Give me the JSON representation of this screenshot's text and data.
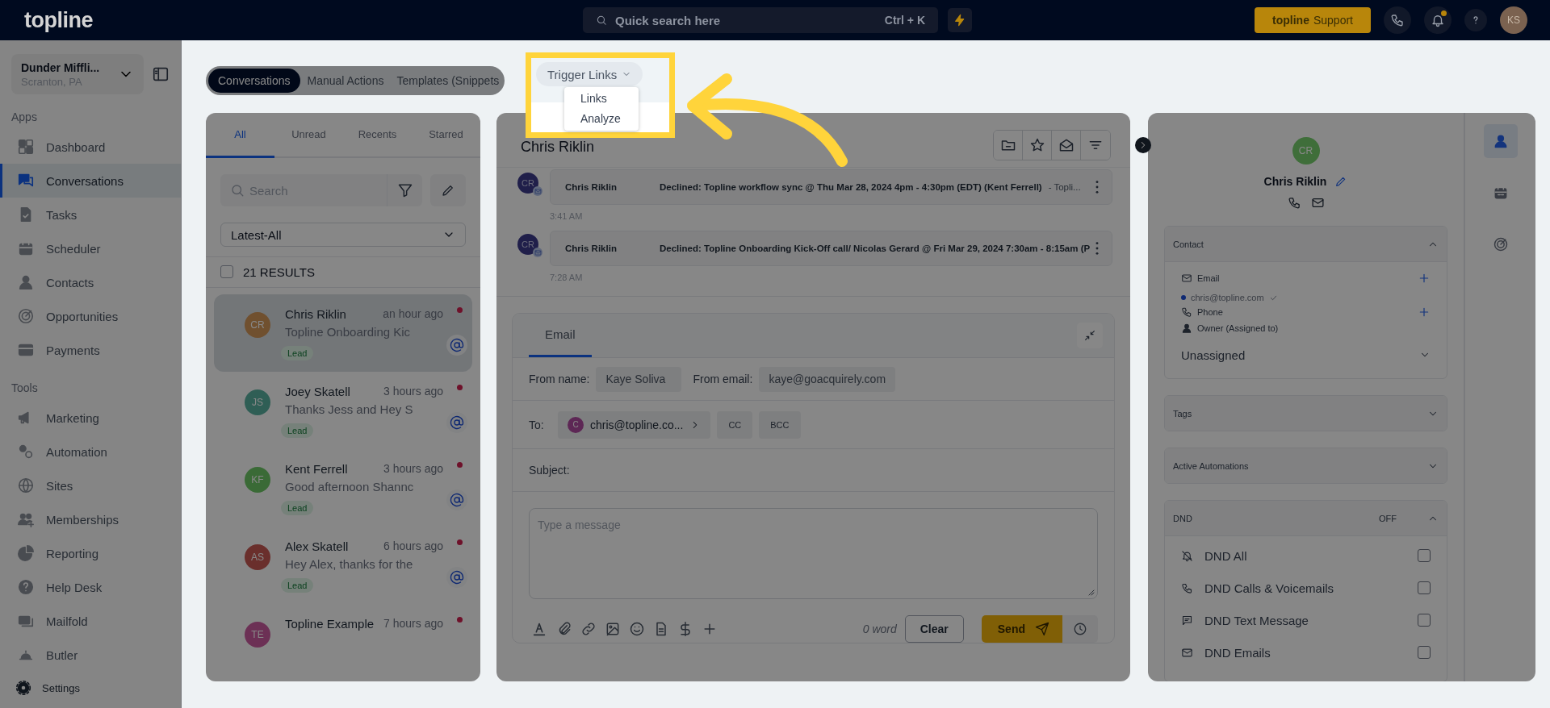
{
  "topbar": {
    "logo": "topline",
    "search": {
      "placeholder": "Quick search here",
      "shortcut": "Ctrl + K"
    },
    "support": {
      "brand": "topline",
      "label": "Support"
    },
    "notifications_unread": true,
    "avatar": "KS"
  },
  "sidebar": {
    "account": {
      "name": "Dunder Miffli...",
      "location": "Scranton, PA"
    },
    "sections": [
      {
        "title": "Apps",
        "items": [
          {
            "kind": "dashboard",
            "label": "Dashboard",
            "selected": false
          },
          {
            "kind": "conversations",
            "label": "Conversations",
            "selected": true
          },
          {
            "kind": "tasks",
            "label": "Tasks",
            "selected": false
          },
          {
            "kind": "scheduler",
            "label": "Scheduler",
            "selected": false
          },
          {
            "kind": "contacts",
            "label": "Contacts",
            "selected": false
          },
          {
            "kind": "opportunities",
            "label": "Opportunities",
            "selected": false
          },
          {
            "kind": "payments",
            "label": "Payments",
            "selected": false
          }
        ]
      },
      {
        "title": "Tools",
        "items": [
          {
            "kind": "marketing",
            "label": "Marketing",
            "selected": false
          },
          {
            "kind": "automation",
            "label": "Automation",
            "selected": false
          },
          {
            "kind": "sites",
            "label": "Sites",
            "selected": false
          },
          {
            "kind": "memberships",
            "label": "Memberships",
            "selected": false
          },
          {
            "kind": "reporting",
            "label": "Reporting",
            "selected": false
          },
          {
            "kind": "helpdesk",
            "label": "Help Desk",
            "selected": false
          },
          {
            "kind": "mailfold",
            "label": "Mailfold",
            "selected": false
          },
          {
            "kind": "butler",
            "label": "Butler",
            "selected": false
          }
        ]
      }
    ],
    "settings": "Settings"
  },
  "tabs": [
    {
      "label": "Conversations",
      "selected": true
    },
    {
      "label": "Manual Actions",
      "selected": false
    },
    {
      "label": "Templates (Snippets",
      "selected": false
    }
  ],
  "trigger_tab": {
    "label": "Trigger Links",
    "expanded": true,
    "menu": [
      "Links",
      "Analyze"
    ]
  },
  "inbox": {
    "filters": [
      {
        "label": "All",
        "selected": true
      },
      {
        "label": "Unread",
        "selected": false
      },
      {
        "label": "Recents",
        "selected": false
      },
      {
        "label": "Starred",
        "selected": false
      }
    ],
    "search": {
      "placeholder": "Search"
    },
    "sort": "Latest-All",
    "results": {
      "label": "21 RESULTS",
      "checked": false
    },
    "conversations": [
      {
        "initials": "CR",
        "color": "#70502f",
        "name": "Chris Riklin",
        "time": "an hour ago",
        "preview": "Topline Onboarding Kic",
        "tag": "Lead",
        "unread": true,
        "selected": true
      },
      {
        "initials": "JS",
        "color": "#2f5e55",
        "name": "Joey Skatell",
        "time": "3 hours ago",
        "preview": "Thanks Jess and Hey S",
        "tag": "Lead",
        "unread": true,
        "selected": false
      },
      {
        "initials": "KF",
        "color": "#3a6a36",
        "name": "Kent Ferrell",
        "time": "3 hours ago",
        "preview": "Good afternoon Shannc",
        "tag": "Lead",
        "unread": true,
        "selected": false
      },
      {
        "initials": "AS",
        "color": "#6a2f2c",
        "name": "Alex Skatell",
        "time": "6 hours ago",
        "preview": "Hey Alex, thanks for the",
        "tag": "Lead",
        "unread": true,
        "selected": false
      },
      {
        "initials": "TE",
        "color": "#6c3055",
        "name": "Topline Example",
        "time": "7 hours ago",
        "unread": true,
        "selected": false
      }
    ]
  },
  "conversation": {
    "title": "Chris Riklin",
    "messages": [
      {
        "initials": "CR",
        "sender": "Chris Riklin",
        "subject": "Declined: Topline workflow sync @ Thu Mar 28, 2024 4pm - 4:30pm (EDT) (Kent Ferrell)",
        "snippet": "-  Topli...",
        "time": "3:41 AM"
      },
      {
        "initials": "CR",
        "sender": "Chris Riklin",
        "subject": "Declined: Topline Onboarding Kick-Off call/ Nicolas Gerard @ Fri Mar 29, 2024 7:30am - 8:15am (P",
        "time": "7:28 AM"
      }
    ]
  },
  "composer": {
    "tabs": [
      {
        "label": "Email",
        "selected": true
      }
    ],
    "from_name": {
      "label": "From name:",
      "value": "Kaye Soliva"
    },
    "from_email": {
      "label": "From email:",
      "value": "kaye@goacquirely.com"
    },
    "to": {
      "label": "To:",
      "initials": "C",
      "email": "chris@topline.co..."
    },
    "cc": "CC",
    "bcc": "BCC",
    "subject_label": "Subject:",
    "message": {
      "placeholder": "Type a message"
    },
    "word_count": "0 word",
    "clear": "Clear",
    "send": "Send"
  },
  "contact": {
    "initials": "CR",
    "color": "#3f6e3a",
    "name": "Chris Riklin",
    "details": {
      "title": "Contact",
      "expanded": true,
      "email_label": "Email",
      "email": "chris@topline.com",
      "email_verified": true,
      "phone_label": "Phone",
      "owner_label": "Owner (Assigned to)",
      "owner": "Unassigned"
    },
    "tags": {
      "title": "Tags",
      "expanded": false
    },
    "automations": {
      "title": "Active Automations",
      "expanded": false
    },
    "dnd": {
      "title": "DND",
      "status": "OFF",
      "expanded": true,
      "options": [
        {
          "kind": "all",
          "label": "DND All",
          "checked": false
        },
        {
          "kind": "calls",
          "label": "DND Calls & Voicemails",
          "checked": false
        },
        {
          "kind": "text",
          "label": "DND Text Message",
          "checked": false
        },
        {
          "kind": "emails",
          "label": "DND Emails",
          "checked": false
        }
      ]
    }
  },
  "rail": [
    {
      "kind": "person",
      "selected": true
    },
    {
      "kind": "calendar",
      "selected": false
    },
    {
      "kind": "target",
      "selected": false
    }
  ]
}
